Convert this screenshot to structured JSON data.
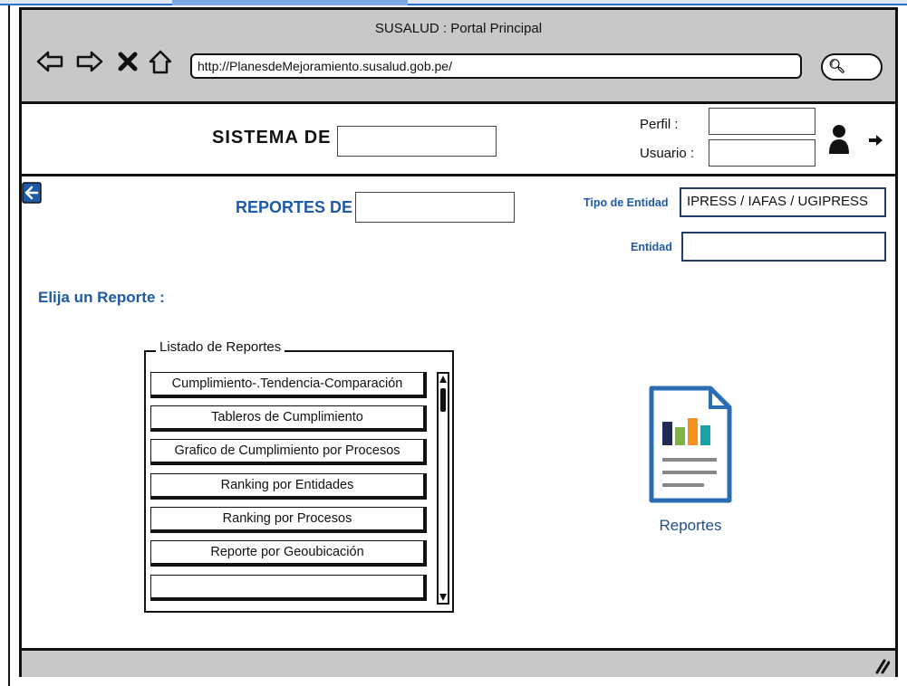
{
  "window": {
    "title": "SUSALUD : Portal Principal"
  },
  "browser": {
    "url": "http://PlanesdeMejoramiento.susalud.gob.pe/"
  },
  "header": {
    "system_label": "SISTEMA DE",
    "perfil_label": "Perfil :",
    "usuario_label": "Usuario :"
  },
  "main": {
    "reports_title": "REPORTES DE",
    "tipo_entidad_label": "Tipo de Entidad",
    "tipo_entidad_value": "IPRESS / IAFAS / UGIPRESS",
    "entidad_label": "Entidad",
    "choose_label": "Elija un Reporte :",
    "list_legend": "Listado de Reportes",
    "reports": [
      "Cumplimiento-.Tendencia-Comparación",
      "Tableros de Cumplimiento",
      "Grafico de Cumplimiento por Procesos",
      "Ranking por Entidades",
      "Ranking por Procesos",
      "Reporte por Geoubicación",
      ""
    ],
    "icon_label": "Reportes"
  },
  "colors": {
    "accent": "#1f5aa8",
    "chrome": "#c8c8c8"
  }
}
